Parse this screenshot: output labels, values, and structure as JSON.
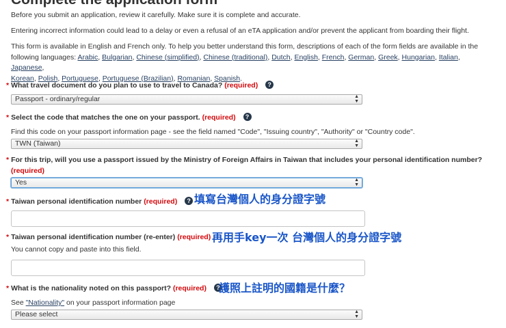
{
  "page": {
    "title": "Complete the application form"
  },
  "intro": {
    "p1": "Before you submit an application, review it carefully. Make sure it is complete and accurate.",
    "p2": "Entering incorrect information could lead to a delay or even a refusal of an eTA application and/or prevent the applicant from boarding their flight.",
    "p3_line1": "This form is available in English and French only. To help you better understand this form, descriptions of each of the form fields are available in the",
    "p3_prefix": "following languages:",
    "languages_line1": [
      "Arabic",
      "Bulgarian",
      "Chinese (simplified)",
      "Chinese (traditional)",
      "Dutch",
      "English",
      "French",
      "German",
      "Greek",
      "Hungarian",
      "Italian",
      "Japanese"
    ],
    "languages_line2": [
      "Korean",
      "Polish",
      "Portuguese",
      "Portuguese (Brazilian)",
      "Romanian",
      "Spanish"
    ]
  },
  "required_text": "(required)",
  "star": "*",
  "help_glyph": "?",
  "q1": {
    "label": "What travel document do you plan to use to travel to Canada?",
    "selected": "Passport - ordinary/regular"
  },
  "q2": {
    "label": "Select the code that matches the one on your passport.",
    "hint": "Find this code on your passport information page - see the field named \"Code\", \"Issuing country\", \"Authority\" or \"Country code\".",
    "selected": "TWN (Taiwan)"
  },
  "q3": {
    "label": "For this trip, will you use a passport issued by the Ministry of Foreign Affairs in Taiwan that includes your personal identification number?",
    "selected": "Yes"
  },
  "q4": {
    "label": "Taiwan personal identification number",
    "value": "",
    "annotation": "填寫台灣個人的身分證字號"
  },
  "q5": {
    "label": "Taiwan personal identification number (re-enter)",
    "hint": "You cannot copy and paste into this field.",
    "value": "",
    "annotation": "再用手key一次 台灣個人的身分證字號"
  },
  "q6": {
    "label": "What is the nationality noted on this passport?",
    "hint_prefix": "See ",
    "hint_link": "\"Nationality\"",
    "hint_suffix": " on your passport information page",
    "selected": "Please select",
    "annotation": "護照上註明的國籍是什麼？"
  },
  "colors": {
    "required": "#d3080c",
    "link": "#284162",
    "annotation": "#1a56c8",
    "help_icon": "#26374a"
  }
}
